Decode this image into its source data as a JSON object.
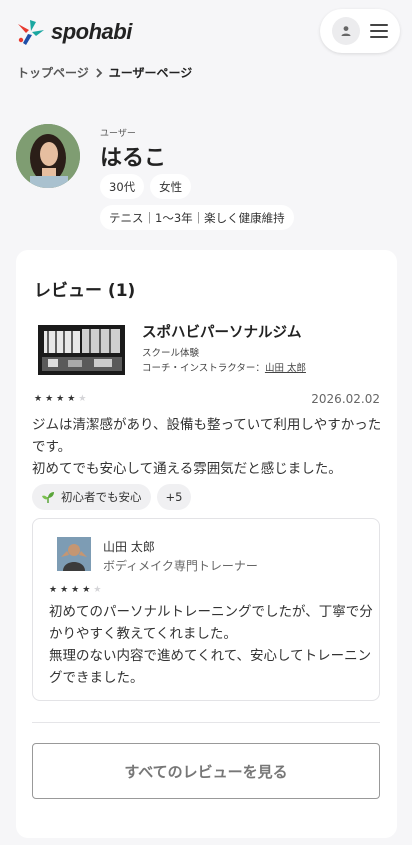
{
  "header": {
    "logo_text": "spohabi",
    "brand_colors": [
      "#e8392f",
      "#1aa7a1",
      "#1e4ea8"
    ]
  },
  "breadcrumb": {
    "items": [
      "トップページ",
      "ユーザーページ"
    ]
  },
  "profile": {
    "label": "ユーザー",
    "name": "はるこ",
    "tags": [
      "30代",
      "女性"
    ],
    "sport_info": "テニス｜1〜3年｜楽しく健康維持"
  },
  "reviews": {
    "title": "レビュー (1)",
    "item": {
      "gym_name": "スポハビパーソナルジム",
      "gym_type": "スクール体験",
      "coach_prefix": "コーチ・インストラクター：",
      "coach_link": "山田 太郎",
      "rating": 4,
      "rating_max": 5,
      "date": "2026.02.02",
      "text_line1": "ジムは清潔感があり、設備も整っていて利用しやすかったです。",
      "text_line2": "初めてでも安心して通える雰囲気だと感じました。",
      "features": [
        "初心者でも安心"
      ],
      "more_count": "+5",
      "reply": {
        "name": "山田 太郎",
        "role": "ボディメイク専門トレーナー",
        "rating": 4,
        "text_line1": "初めてのパーソナルトレーニングでしたが、丁寧で分かりやすく教えてくれました。",
        "text_line2": "無理のない内容で進めてくれて、安心してトレーニングできました。"
      }
    },
    "all_button": "すべてのレビューを見る"
  },
  "colors": {
    "star_filled": "#333333",
    "star_empty": "#d5d5d8",
    "leaf_green": "#5aa53a"
  }
}
